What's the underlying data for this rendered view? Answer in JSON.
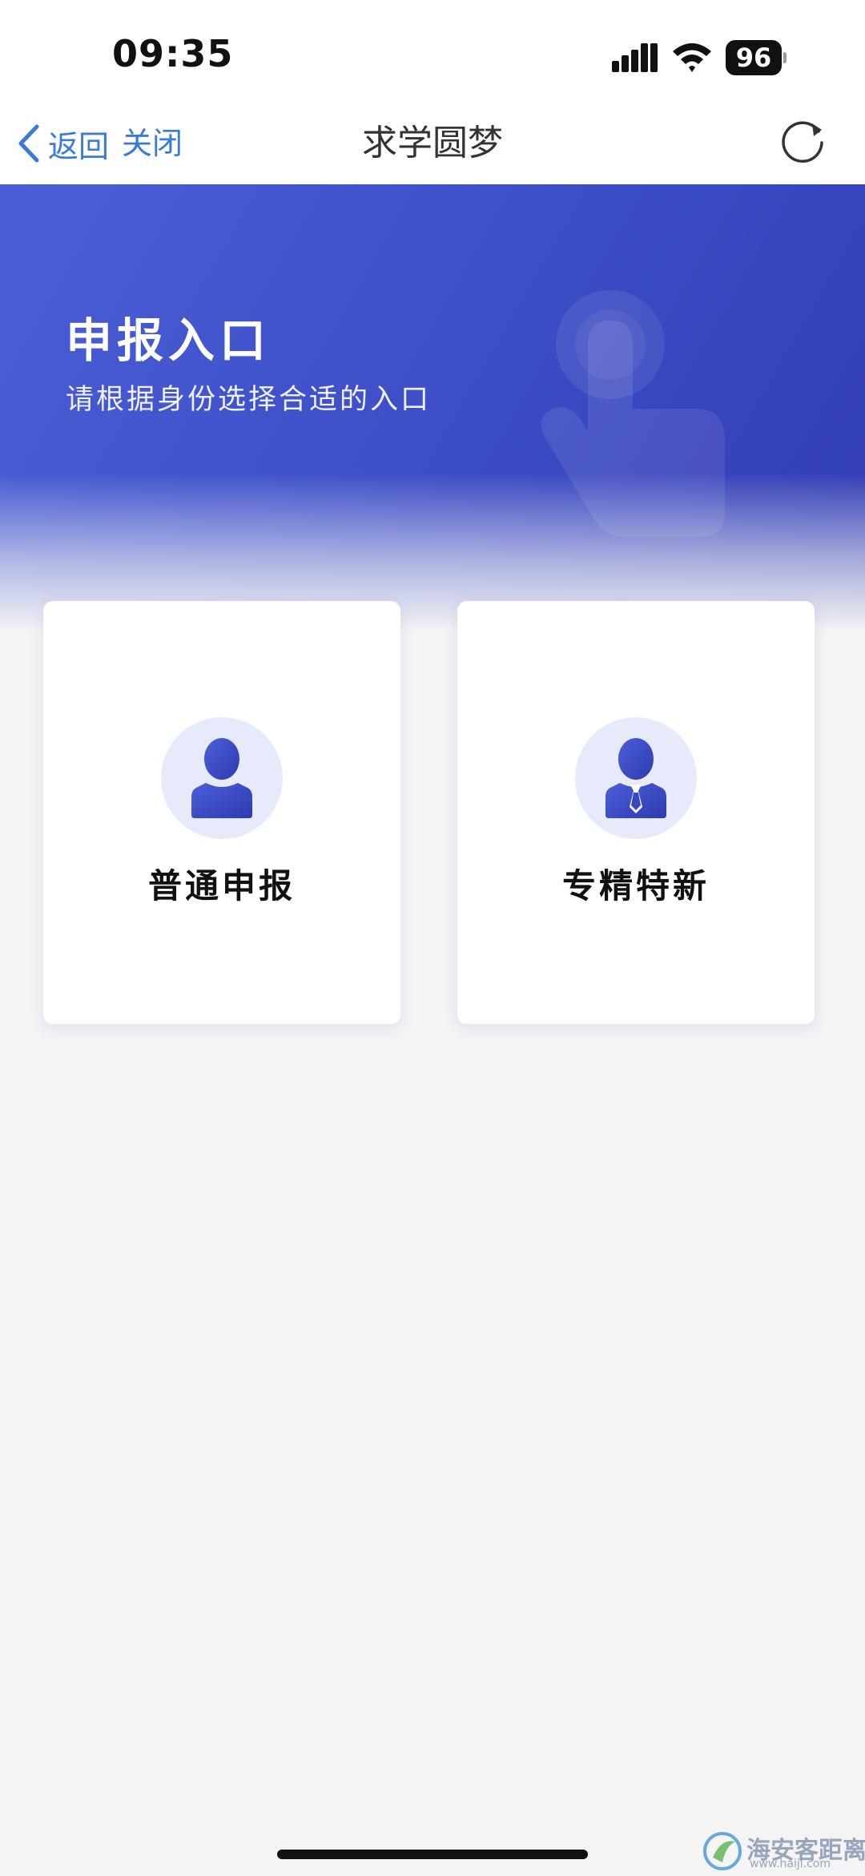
{
  "status_bar": {
    "time": "09:35",
    "battery": "96",
    "icons": [
      "signal-icon",
      "wifi-icon",
      "battery-icon"
    ]
  },
  "nav": {
    "back_label": "返回",
    "close_label": "关闭",
    "title": "求学圆梦",
    "icons": [
      "chevron-left-icon",
      "refresh-icon"
    ],
    "link_color": "#3a7bd5"
  },
  "hero": {
    "title": "申报入口",
    "subtitle": "请根据身份选择合适的入口",
    "icon": "hand-pointer-icon",
    "gradient_colors": [
      "#4a5fd6",
      "#3039b0"
    ]
  },
  "cards": [
    {
      "label": "普通申报",
      "icon": "person-icon"
    },
    {
      "label": "专精特新",
      "icon": "person-tie-icon"
    }
  ],
  "colors": {
    "accent": "#3e4fc8",
    "background": "#f4f4f5",
    "avatar_bg": "#e6eafb"
  },
  "watermark": {
    "text": "海安客距离",
    "sub": "www.haiji.com",
    "icon": "watermark-logo-icon"
  }
}
